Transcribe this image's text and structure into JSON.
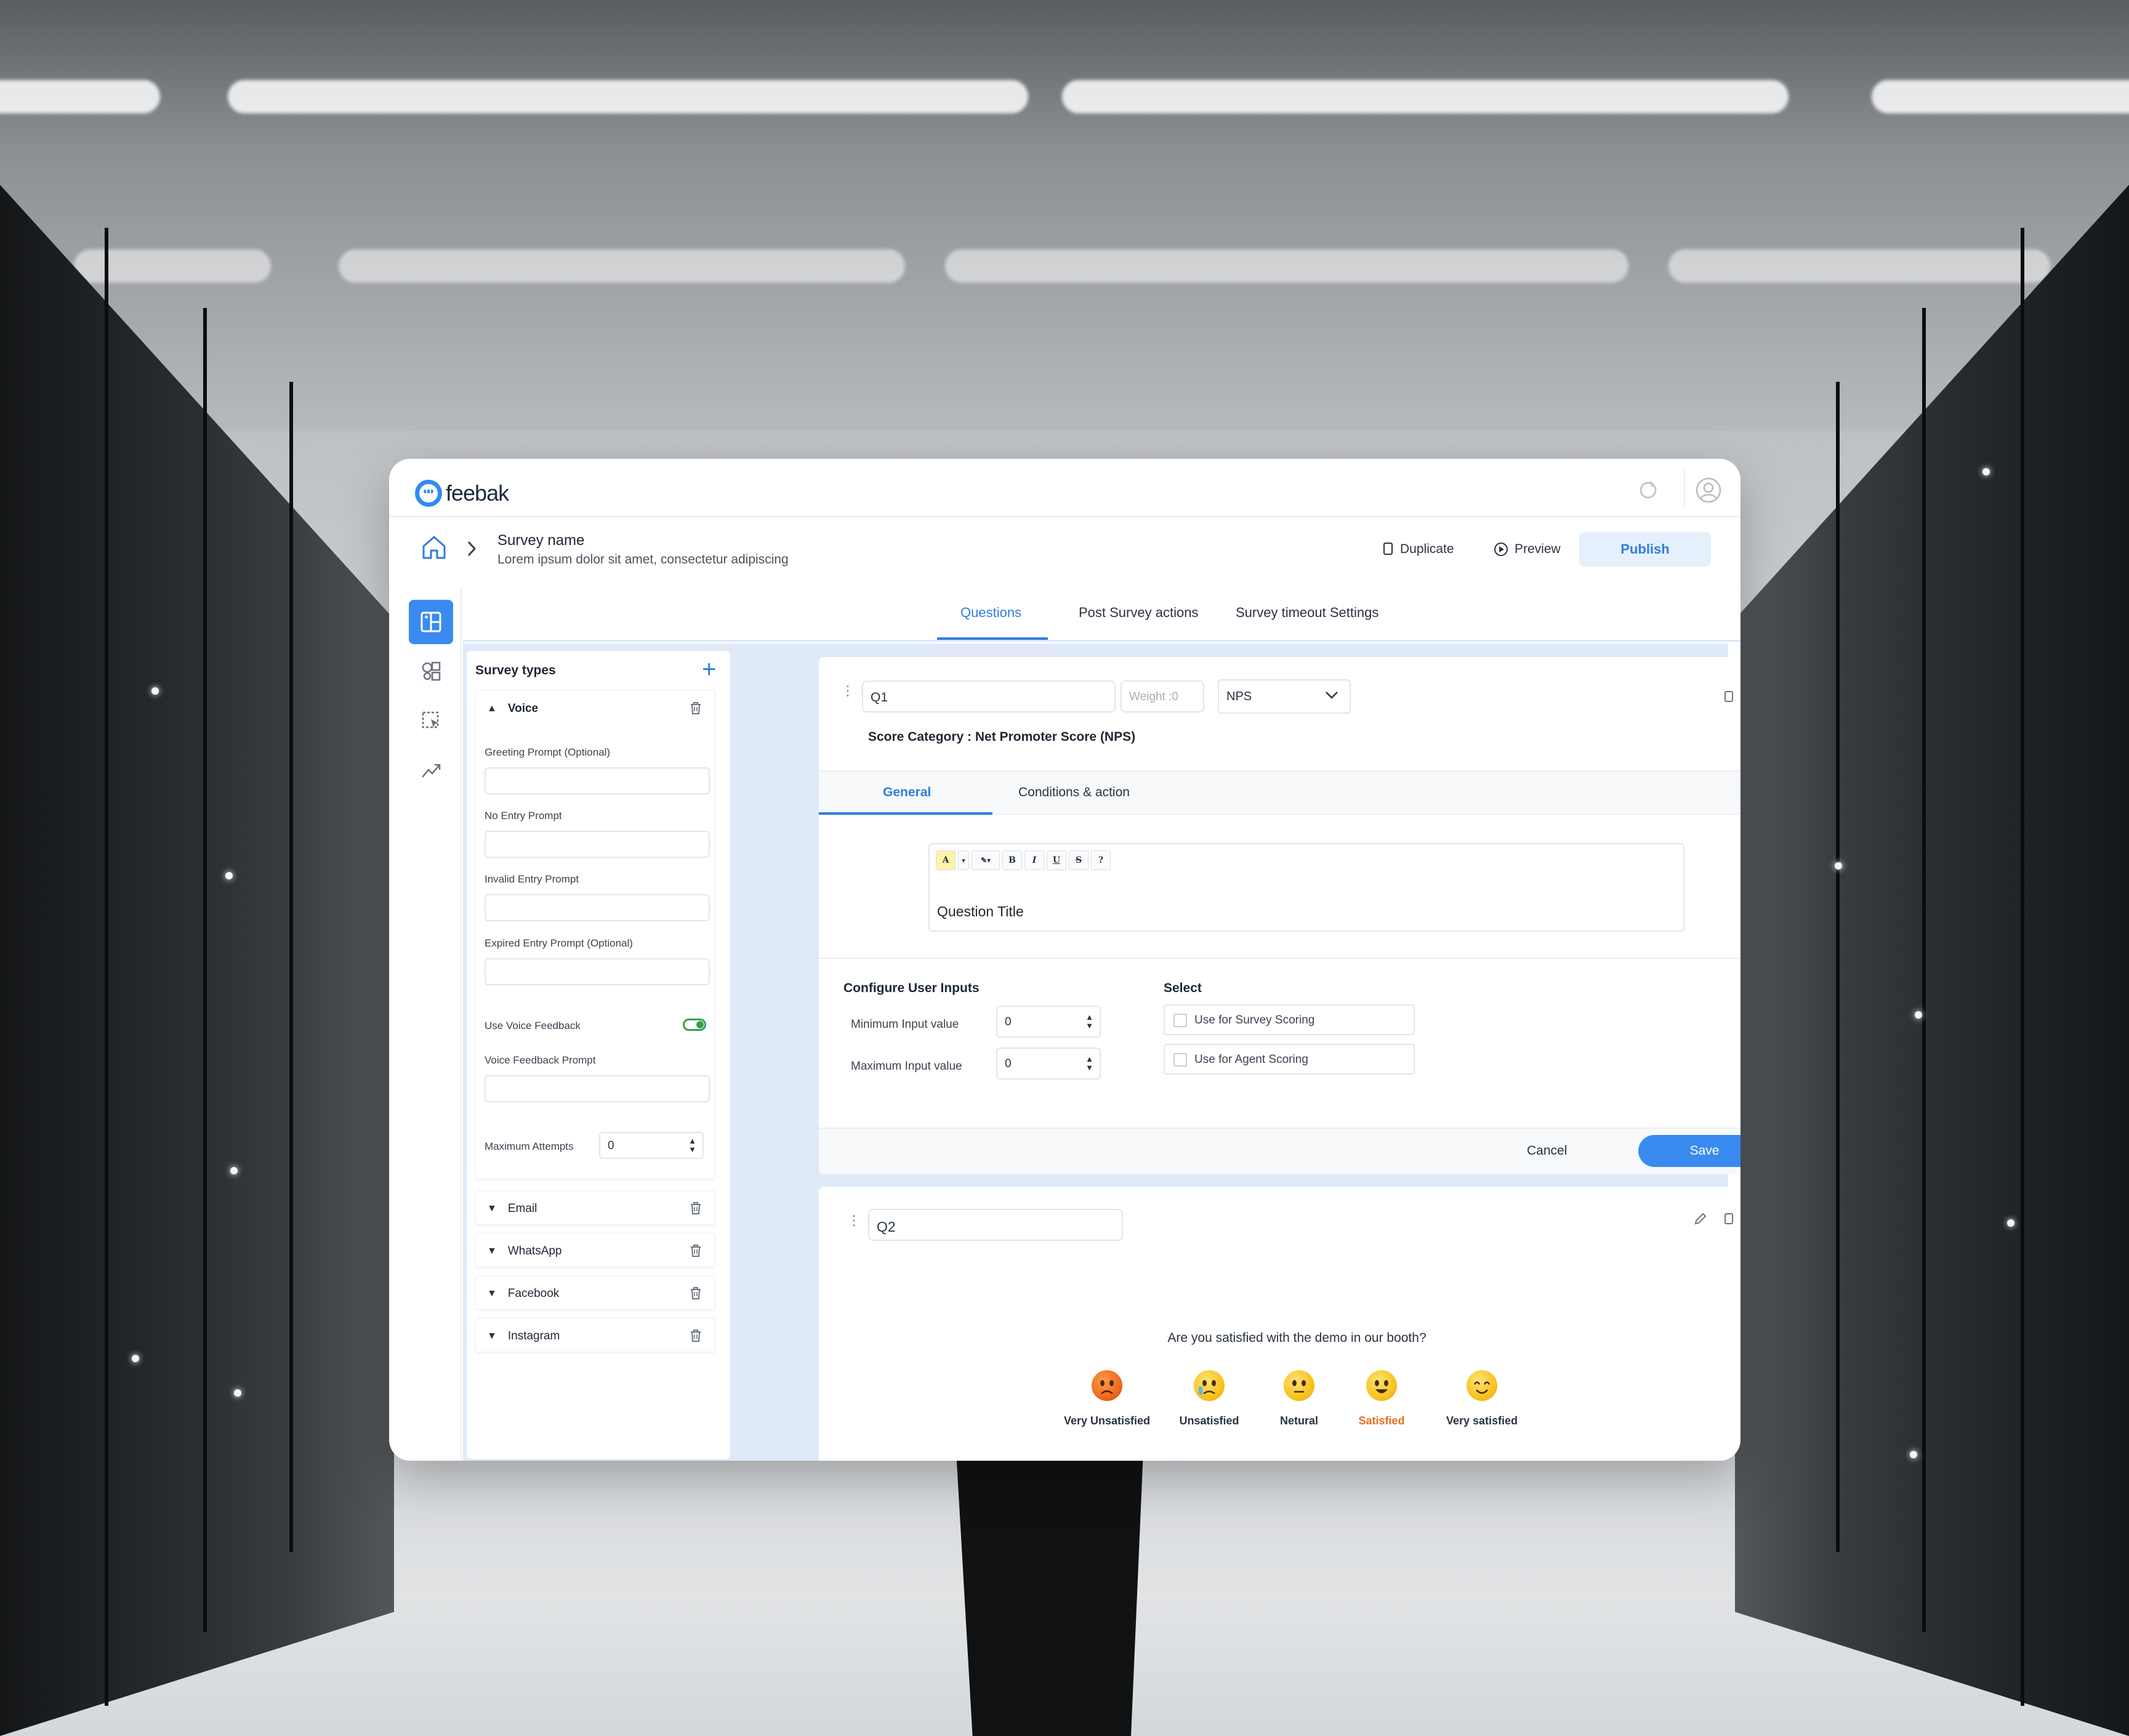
{
  "app": {
    "logo_text": "feebak"
  },
  "breadcrumb": {
    "survey_name": "Survey name",
    "survey_description": "Lorem ipsum dolor sit amet, consectetur adipiscing"
  },
  "header_actions": {
    "duplicate": "Duplicate",
    "preview": "Preview",
    "publish": "Publish"
  },
  "tabs": [
    {
      "label": "Questions",
      "active": true
    },
    {
      "label": "Post Survey actions",
      "active": false
    },
    {
      "label": "Survey timeout Settings",
      "active": false
    }
  ],
  "survey_types": {
    "title": "Survey types",
    "voice": {
      "label": "Voice",
      "greeting_prompt": "Greeting Prompt  (Optional)",
      "no_entry_prompt": "No Entry Prompt",
      "invalid_entry_prompt": "Invalid Entry Prompt",
      "expired_entry_prompt": "Expired Entry Prompt  (Optional)",
      "use_voice_feedback": "Use Voice Feedback",
      "use_voice_feedback_on": true,
      "voice_feedback_prompt": "Voice Feedback Prompt",
      "maximum_attempts": "Maximum Attempts",
      "maximum_attempts_value": "0"
    },
    "collapsed": [
      {
        "label": "Email"
      },
      {
        "label": "WhatsApp"
      },
      {
        "label": "Facebook"
      },
      {
        "label": "Instagram"
      }
    ]
  },
  "q1": {
    "id": "Q1",
    "weight_placeholder": "Weight :0",
    "type": "NPS",
    "score_category": "Score Category : Net Promoter Score (NPS)",
    "subtabs": [
      {
        "label": "General",
        "active": true
      },
      {
        "label": "Conditions & action",
        "active": false
      }
    ],
    "toolbar": [
      "A",
      "▾",
      "✎▾",
      "B",
      "I",
      "U",
      "S",
      "?"
    ],
    "question_title": "Question Title",
    "configure_user_inputs": "Configure User Inputs",
    "min_input_label": "Minimum Input value",
    "min_input_value": "0",
    "max_input_label": "Maximum Input value",
    "max_input_value": "0",
    "select_title": "Select",
    "use_for_survey_scoring": "Use for Survey Scoring",
    "use_for_agent_scoring": "Use for Agent Scoring",
    "cancel": "Cancel",
    "save": "Save"
  },
  "q2": {
    "id": "Q2",
    "question": "Are you satisfied with the demo in our booth?",
    "options": [
      {
        "label": "Very Unsatisfied",
        "icon": "angry-face-icon",
        "selected": false
      },
      {
        "label": "Unsatisfied",
        "icon": "crying-face-icon",
        "selected": false
      },
      {
        "label": "Netural",
        "icon": "neutral-face-icon",
        "selected": false
      },
      {
        "label": "Satisfied",
        "icon": "smiling-face-icon",
        "selected": true
      },
      {
        "label": "Very satisfied",
        "icon": "happy-face-icon",
        "selected": false
      }
    ]
  },
  "colors": {
    "accent": "#3a8bf0",
    "selected_option": "#ec6c1f",
    "toggle_on": "#2fa34a"
  }
}
